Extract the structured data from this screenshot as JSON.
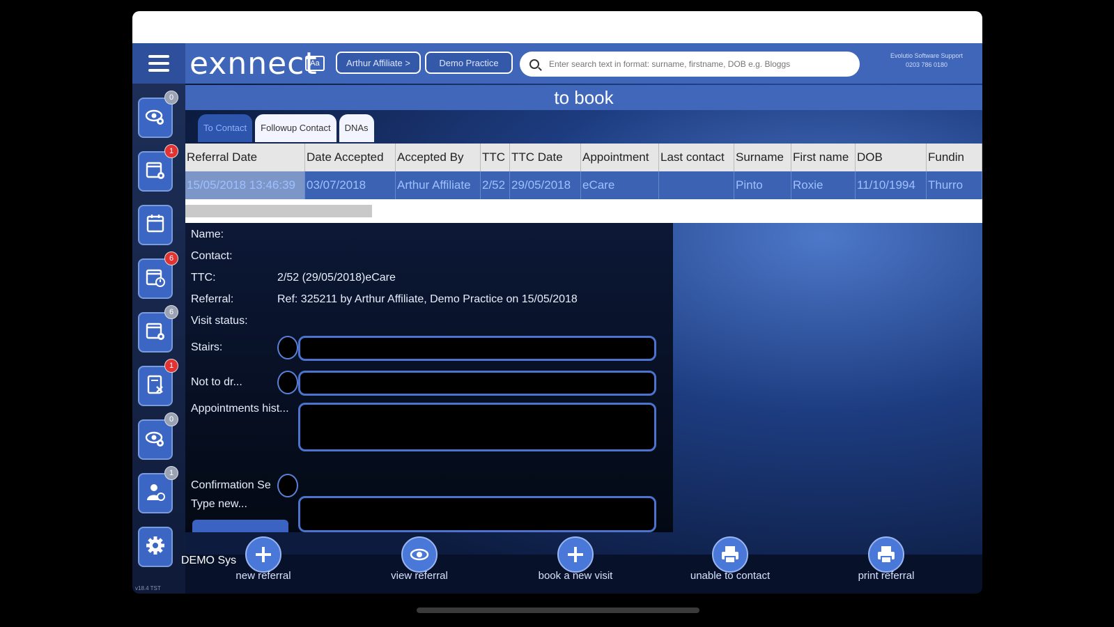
{
  "header": {
    "logo_text": "exnnect",
    "logo_badge": "Aa",
    "affiliate_button": "Arthur Affiliate >",
    "practice_button": "Demo Practice",
    "search_placeholder": "Enter search text in format: surname, firstname, DOB e.g. Bloggs",
    "support_line1": "Evolutio Software Support",
    "support_line2": "0203 786 0180"
  },
  "sidebar": {
    "items": [
      {
        "icon": "eye-gear-icon",
        "badge": "0",
        "badge_color": "#9aa3b5"
      },
      {
        "icon": "calendar-gear-icon",
        "badge": "1",
        "badge_color": "#e23232"
      },
      {
        "icon": "calendar-icon",
        "badge": "",
        "badge_color": ""
      },
      {
        "icon": "calendar-clock-icon",
        "badge": "6",
        "badge_color": "#e23232"
      },
      {
        "icon": "calendar-gear-icon",
        "badge": "6",
        "badge_color": "#9aa3b5"
      },
      {
        "icon": "document-x-icon",
        "badge": "1",
        "badge_color": "#e23232"
      },
      {
        "icon": "eye-gear-icon",
        "badge": "0",
        "badge_color": "#9aa3b5"
      },
      {
        "icon": "person-clock-icon",
        "badge": "1",
        "badge_color": "#9aa3b5"
      },
      {
        "icon": "settings-gear-icon",
        "badge": "",
        "badge_color": ""
      }
    ],
    "demo_label": "DEMO Sys",
    "version": "v18.4 TST"
  },
  "main": {
    "title": "to book",
    "tabs": [
      {
        "label": "To Contact",
        "active": true
      },
      {
        "label": "Followup Contact",
        "active": false
      },
      {
        "label": "DNAs",
        "active": false
      }
    ],
    "table": {
      "columns": [
        "Referral Date",
        "Date Accepted",
        "Accepted By",
        "TTC",
        "TTC Date",
        "Appointment",
        "Last contact",
        "Surname",
        "First name",
        "DOB",
        "Fundin"
      ],
      "rows": [
        [
          "15/05/2018 13:46:39",
          "03/07/2018",
          "Arthur Affiliate",
          "2/52",
          "29/05/2018",
          "eCare",
          "",
          "Pinto",
          "Roxie",
          "11/10/1994",
          "Thurro"
        ]
      ]
    }
  },
  "detail": {
    "name_label": "Name:",
    "contact_label": "Contact:",
    "ttc_label": "TTC:",
    "ttc_value": "2/52 (29/05/2018)eCare",
    "referral_label": "Referral:",
    "referral_value": "Ref: 325211 by Arthur Affiliate, Demo Practice on 15/05/2018",
    "visit_status_label": "Visit status:",
    "stairs_label": "Stairs:",
    "nok_label": "Not to dr...",
    "appointments_label": "Appointments hist...",
    "confirmation_label": "Confirmation Se",
    "type_new_label": "Type new..."
  },
  "footer": {
    "buttons": [
      {
        "label": "new referral",
        "icon": "plus-icon"
      },
      {
        "label": "view referral",
        "icon": "eye-icon"
      },
      {
        "label": "book a new visit",
        "icon": "plus-icon"
      },
      {
        "label": "unable to contact",
        "icon": "printer-icon"
      },
      {
        "label": "print referral",
        "icon": "printer-icon"
      }
    ]
  },
  "colors": {
    "header_blue": "#3f66b8",
    "selected_row_blue": "#3c63b3",
    "badge_red": "#e23232",
    "field_border_blue": "#4a74d0"
  }
}
